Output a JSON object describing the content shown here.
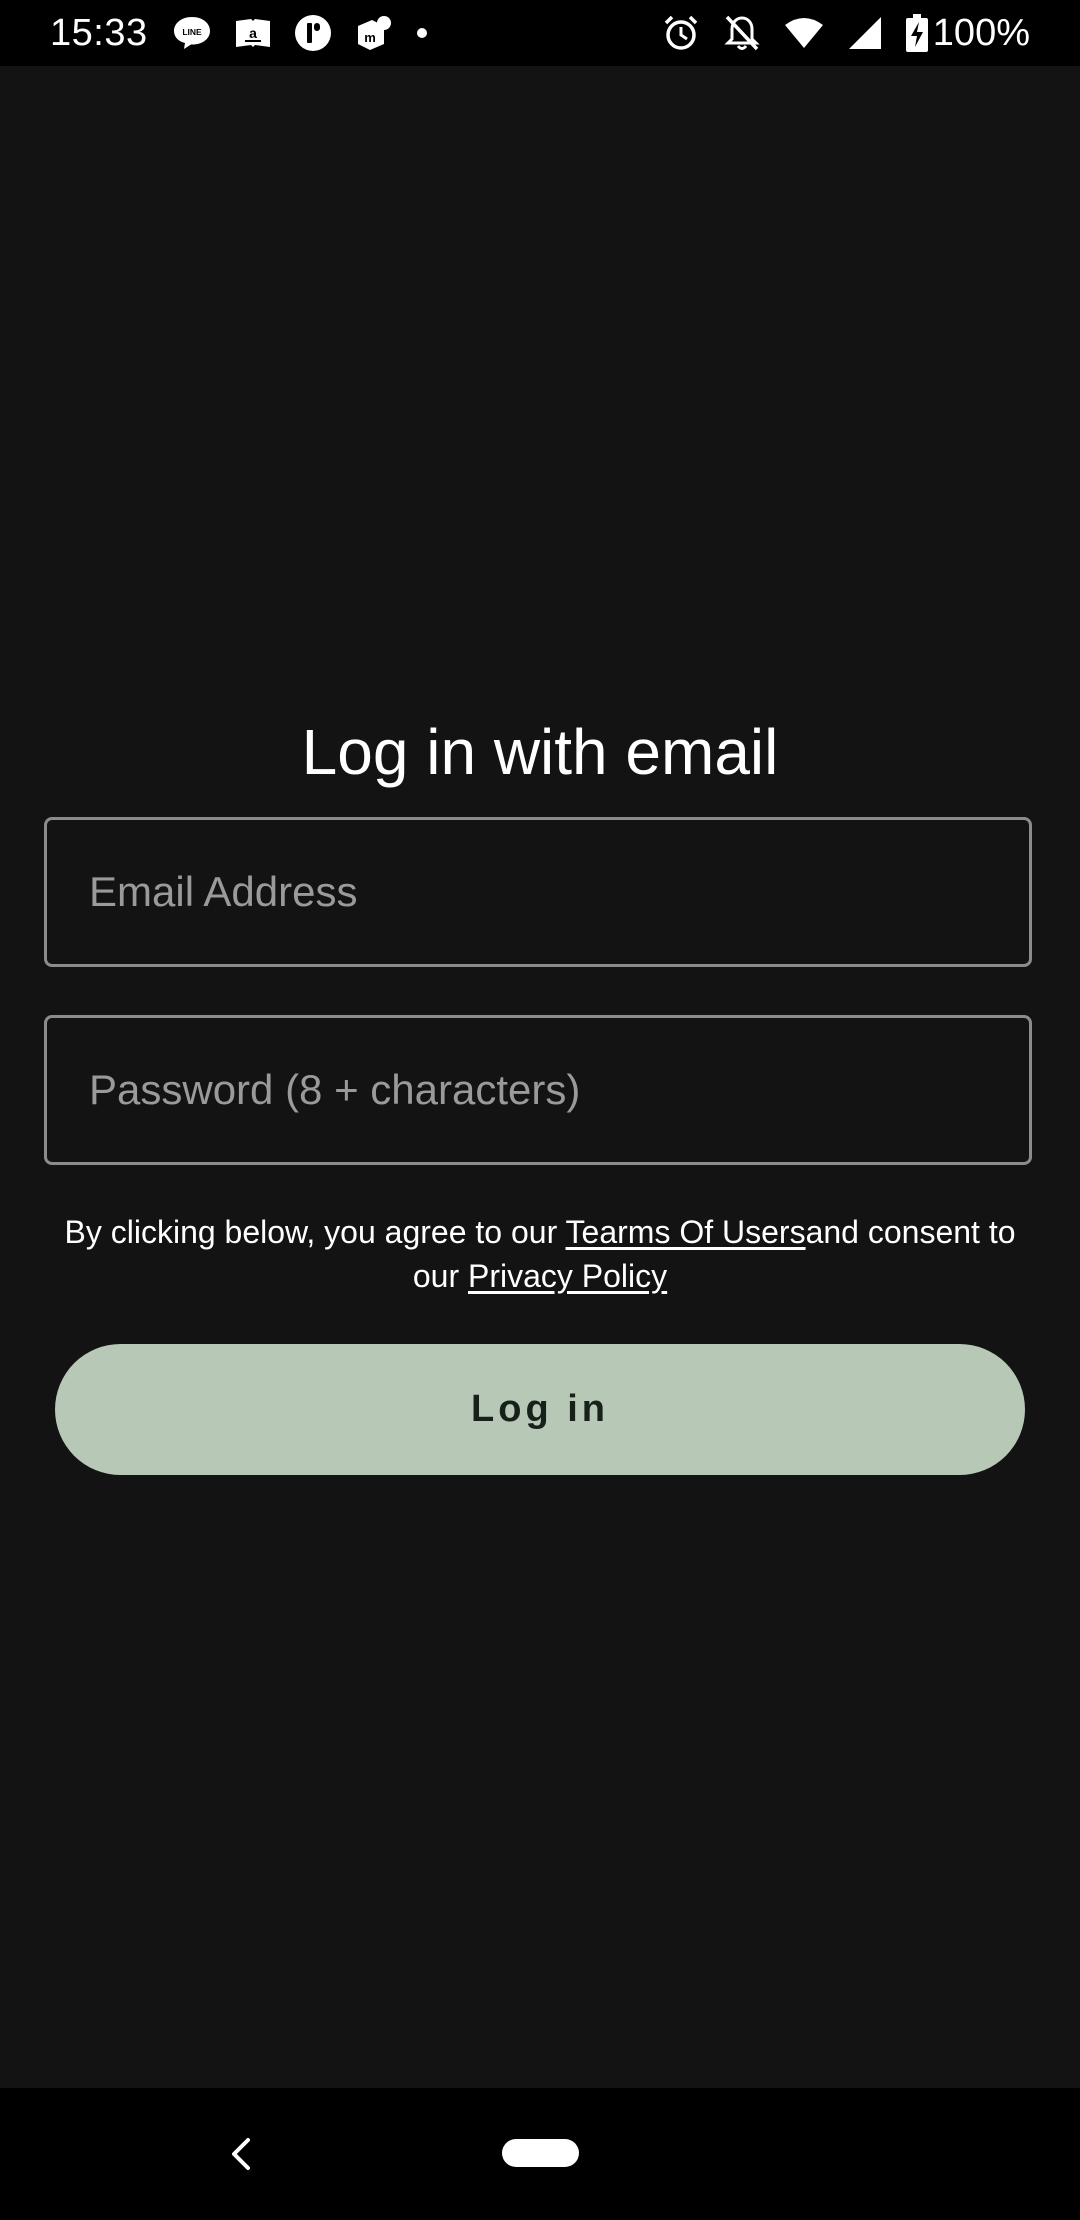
{
  "status_bar": {
    "time": "15:33",
    "battery_percent": "100%",
    "notification_icons": [
      "line-app-icon",
      "book-icon",
      "t-app-icon",
      "m-app-icon",
      "more-dot-icon"
    ],
    "system_icons": [
      "alarm-icon",
      "notifications-off-icon",
      "wifi-icon",
      "cell-signal-icon",
      "battery-charging-icon"
    ]
  },
  "login": {
    "title": "Log in with email",
    "email_placeholder": "Email Address",
    "email_value": "",
    "password_placeholder": "Password (8 + characters)",
    "password_value": "",
    "consent_prefix": "By clicking below, you agree to our ",
    "terms_link": "Tearms Of Users",
    "consent_middle": "and consent to our ",
    "privacy_link": "Privacy Policy",
    "login_button": "Log in"
  },
  "colors": {
    "background": "#131313",
    "button_bg": "#b7c8b7",
    "button_text": "#17211a",
    "field_border": "#8c8c8c",
    "placeholder": "#9a9a9a"
  },
  "nav_bar": {
    "buttons": [
      "back-icon",
      "home-pill"
    ]
  }
}
